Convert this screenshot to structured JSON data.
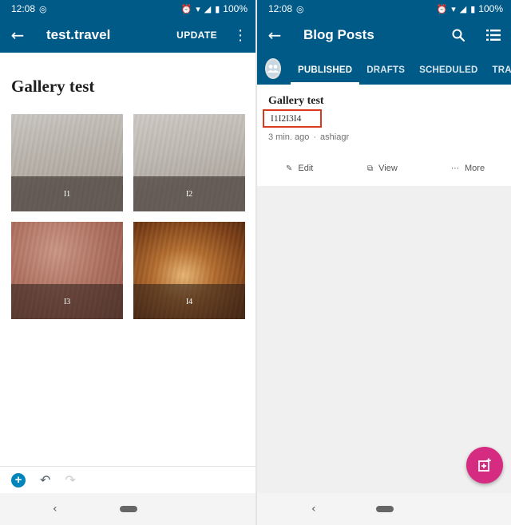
{
  "status_bar": {
    "time": "12:08",
    "battery": "100%"
  },
  "editor": {
    "site_title": "test.travel",
    "update_label": "UPDATE",
    "post_title": "Gallery test",
    "gallery": [
      {
        "caption": "I1"
      },
      {
        "caption": "I2"
      },
      {
        "caption": "I3"
      },
      {
        "caption": "I4"
      }
    ]
  },
  "posts": {
    "title": "Blog Posts",
    "tabs": [
      {
        "label": "PUBLISHED",
        "active": true
      },
      {
        "label": "DRAFTS",
        "active": false
      },
      {
        "label": "SCHEDULED",
        "active": false
      },
      {
        "label": "TRASH",
        "active": false
      }
    ],
    "card": {
      "title": "Gallery test",
      "excerpt": "I1I2I3I4",
      "time_ago": "3 min. ago",
      "separator": "·",
      "author": "ashiagr",
      "actions": {
        "edit": "Edit",
        "view": "View",
        "more": "More"
      }
    }
  },
  "colors": {
    "app_bar": "#005a87",
    "fab": "#d52c82",
    "highlight_box": "#d93a1f"
  }
}
